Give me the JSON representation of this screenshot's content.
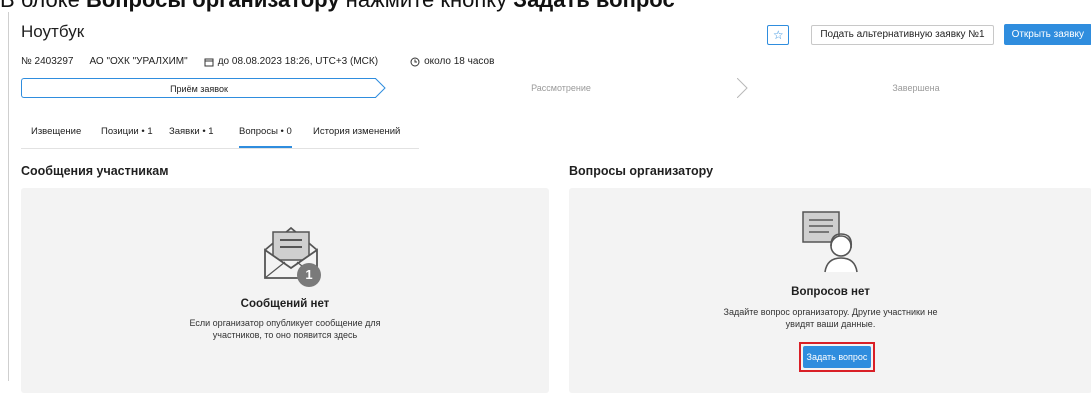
{
  "banner": {
    "pre": "В блоке ",
    "bold1": "Вопросы организатору",
    "mid": " нажмите кнопку ",
    "bold2": "Задать вопрос"
  },
  "header": {
    "title": "Ноутбук",
    "number": "№ 2403297",
    "org": "АО \"ОХК \"УРАЛХИМ\"",
    "deadline": "до 08.08.2023 18:26, UTC+3 (МСК)",
    "remaining": "около 18 часов",
    "alt_button": "Подать альтернативную заявку №1",
    "open_button": "Открыть заявку"
  },
  "stepper": [
    "Приём заявок",
    "Рассмотрение",
    "Завершена"
  ],
  "tabs": [
    "Извещение",
    "Позиции • 1",
    "Заявки • 1",
    "Вопросы • 0",
    "История изменений"
  ],
  "active_tab": "Вопросы • 0",
  "messages": {
    "heading": "Сообщения участникам",
    "empty_title": "Сообщений нет",
    "empty_text_1": "Если организатор опубликует сообщение для",
    "empty_text_2": "участников, то оно появится здесь",
    "badge": "1"
  },
  "questions": {
    "heading": "Вопросы организатору",
    "empty_title": "Вопросов нет",
    "empty_text_1": "Задайте вопрос организатору. Другие участники не",
    "empty_text_2": "увидят ваши данные.",
    "ask_button": "Задать вопрос"
  },
  "colors": {
    "accent": "#2f8dde",
    "highlight": "#d91f26",
    "panel_bg": "#f3f3f3"
  }
}
